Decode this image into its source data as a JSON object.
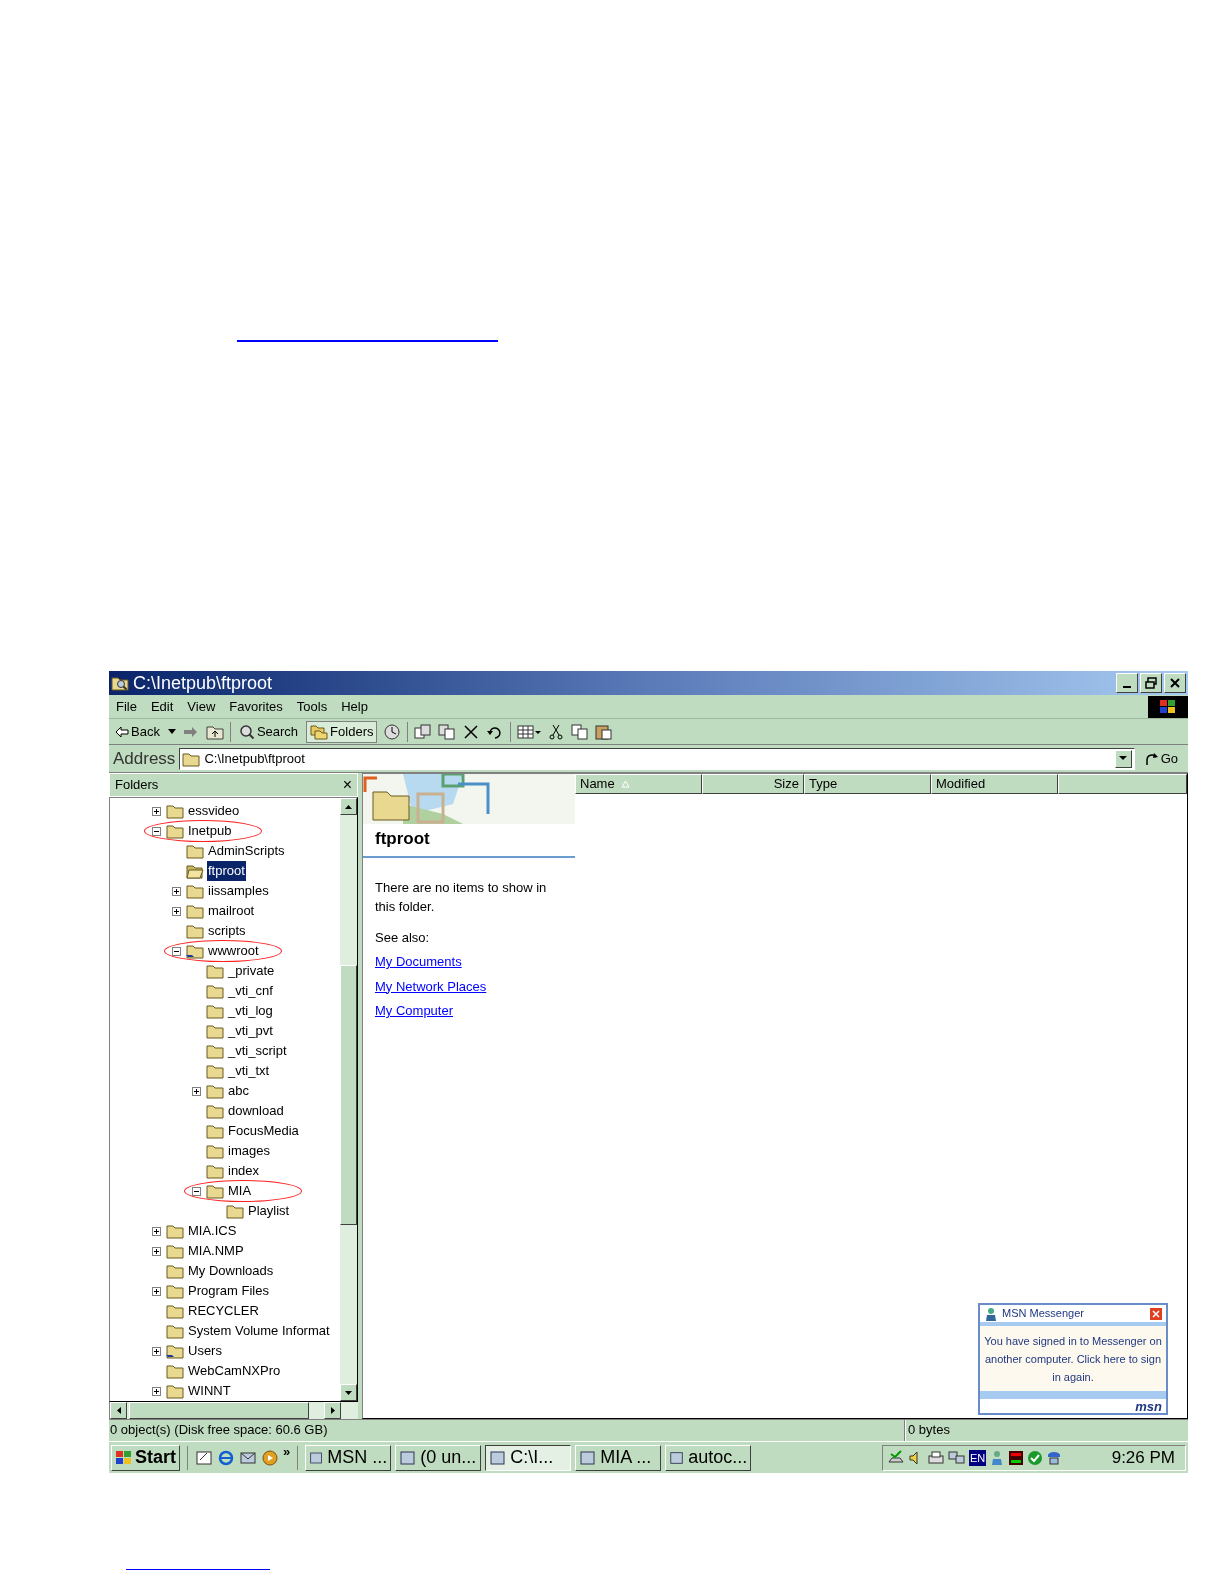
{
  "window": {
    "title": "C:\\Inetpub\\ftproot"
  },
  "menu": [
    "File",
    "Edit",
    "View",
    "Favorites",
    "Tools",
    "Help"
  ],
  "toolbar": [
    {
      "label": "Back",
      "pressed": false
    },
    {
      "label": "Search",
      "pressed": false
    },
    {
      "label": "Folders",
      "pressed": true
    }
  ],
  "address": {
    "label": "Address",
    "value": "C:\\Inetpub\\ftproot",
    "go": "Go"
  },
  "folders_pane": {
    "title": "Folders",
    "close": "×",
    "tree": [
      {
        "name": "essvideo",
        "kind": "folder",
        "expanded": false,
        "selected": false,
        "circled": false
      },
      {
        "name": "Inetpub",
        "kind": "folder",
        "expanded": true,
        "selected": false,
        "circled": true,
        "children": [
          {
            "name": "AdminScripts",
            "kind": "folder",
            "selected": false,
            "circled": false
          },
          {
            "name": "ftproot",
            "kind": "open",
            "selected": true,
            "circled": false
          },
          {
            "name": "iissamples",
            "kind": "folder",
            "expanded": false,
            "selected": false,
            "circled": false
          },
          {
            "name": "mailroot",
            "kind": "folder",
            "expanded": false,
            "selected": false,
            "circled": false
          },
          {
            "name": "scripts",
            "kind": "folder",
            "selected": false,
            "circled": false
          },
          {
            "name": "wwwroot",
            "kind": "shared",
            "expanded": true,
            "selected": false,
            "circled": true,
            "children": [
              {
                "name": "_private",
                "kind": "folder",
                "selected": false,
                "circled": false
              },
              {
                "name": "_vti_cnf",
                "kind": "folder",
                "selected": false,
                "circled": false
              },
              {
                "name": "_vti_log",
                "kind": "folder",
                "selected": false,
                "circled": false
              },
              {
                "name": "_vti_pvt",
                "kind": "folder",
                "selected": false,
                "circled": false
              },
              {
                "name": "_vti_script",
                "kind": "folder",
                "selected": false,
                "circled": false
              },
              {
                "name": "_vti_txt",
                "kind": "folder",
                "selected": false,
                "circled": false
              },
              {
                "name": "abc",
                "kind": "folder",
                "expanded": false,
                "selected": false,
                "circled": false
              },
              {
                "name": "download",
                "kind": "folder",
                "selected": false,
                "circled": false
              },
              {
                "name": "FocusMedia",
                "kind": "folder",
                "selected": false,
                "circled": false
              },
              {
                "name": "images",
                "kind": "folder",
                "selected": false,
                "circled": false
              },
              {
                "name": "index",
                "kind": "folder",
                "selected": false,
                "circled": false
              },
              {
                "name": "MIA",
                "kind": "folder",
                "expanded": true,
                "selected": false,
                "circled": true,
                "children": [
                  {
                    "name": "Playlist",
                    "kind": "folder",
                    "selected": false,
                    "circled": false
                  }
                ]
              }
            ]
          }
        ]
      },
      {
        "name": "MIA.ICS",
        "kind": "folder",
        "expanded": false,
        "selected": false,
        "circled": false
      },
      {
        "name": "MIA.NMP",
        "kind": "folder",
        "expanded": false,
        "selected": false,
        "circled": false
      },
      {
        "name": "My Downloads",
        "kind": "folder",
        "selected": false,
        "circled": false
      },
      {
        "name": "Program Files",
        "kind": "folder",
        "expanded": false,
        "selected": false,
        "circled": false
      },
      {
        "name": "RECYCLER",
        "kind": "folder",
        "selected": false,
        "circled": false
      },
      {
        "name": "System Volume Informat",
        "kind": "folder",
        "selected": false,
        "circled": false
      },
      {
        "name": "Users",
        "kind": "shared",
        "expanded": false,
        "selected": false,
        "circled": false
      },
      {
        "name": "WebCamNXPro",
        "kind": "folder",
        "selected": false,
        "circled": false
      },
      {
        "name": "WINNT",
        "kind": "folder",
        "expanded": false,
        "selected": false,
        "circled": false
      }
    ]
  },
  "web_view": {
    "heading": "ftproot",
    "message": "There are no items to show in this folder.",
    "see_also": "See also:",
    "links": [
      "My Documents",
      "My Network Places",
      "My Computer"
    ]
  },
  "columns": [
    {
      "label": "Name",
      "sorted": true
    },
    {
      "label": "Size",
      "sorted": false
    },
    {
      "label": "Type",
      "sorted": false
    },
    {
      "label": "Modified",
      "sorted": false
    }
  ],
  "status_bar": [
    "0 object(s) (Disk free space: 60.6 GB)",
    "0 bytes"
  ],
  "taskbar": {
    "start": "Start",
    "more": "»",
    "tasks": [
      {
        "label": "MSN ...",
        "selected": false
      },
      {
        "label": "(0 un...",
        "selected": false
      },
      {
        "label": "C:\\I...",
        "selected": true
      },
      {
        "label": "MIA ...",
        "selected": false
      },
      {
        "label": "autoc...",
        "selected": false
      }
    ],
    "language": "EN",
    "clock": "9:26 PM"
  },
  "notification": {
    "title": "MSN Messenger",
    "message": "You have signed in to Messenger on another computer. Click here to sign in again.",
    "logo": "msn"
  }
}
